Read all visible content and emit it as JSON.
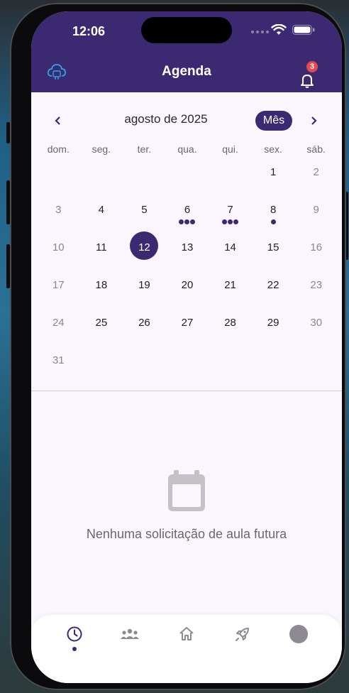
{
  "status": {
    "time": "12:06"
  },
  "appbar": {
    "title": "Agenda",
    "notification_count": "3",
    "ai_icon": "cloud-ai-icon",
    "bell_icon": "bell-icon"
  },
  "calendar": {
    "month_label": "agosto de 2025",
    "view_button": "Mês",
    "weekdays": [
      "dom.",
      "seg.",
      "ter.",
      "qua.",
      "qui.",
      "sex.",
      "sáb."
    ],
    "selected_day": 12,
    "weeks": [
      [
        "",
        "",
        "",
        "",
        "",
        "1",
        "2"
      ],
      [
        "3",
        "4",
        "5",
        "6",
        "7",
        "8",
        "9"
      ],
      [
        "10",
        "11",
        "12",
        "13",
        "14",
        "15",
        "16"
      ],
      [
        "17",
        "18",
        "19",
        "20",
        "21",
        "22",
        "23"
      ],
      [
        "24",
        "25",
        "26",
        "27",
        "28",
        "29",
        "30"
      ],
      [
        "31",
        "",
        "",
        "",
        "",
        "",
        ""
      ]
    ],
    "events": {
      "6": 3,
      "7": 3,
      "8": 1
    }
  },
  "empty_state": {
    "icon": "calendar-icon",
    "message": "Nenhuma solicitação de aula futura"
  },
  "tabs": [
    {
      "icon": "clock-icon",
      "active": true
    },
    {
      "icon": "group-icon",
      "active": false
    },
    {
      "icon": "home-icon",
      "active": false
    },
    {
      "icon": "rocket-icon",
      "active": false
    },
    {
      "icon": "avatar-icon",
      "active": false
    }
  ],
  "colors": {
    "primary": "#3b2a71",
    "badge": "#e5484d",
    "background": "#fbf6fd"
  }
}
